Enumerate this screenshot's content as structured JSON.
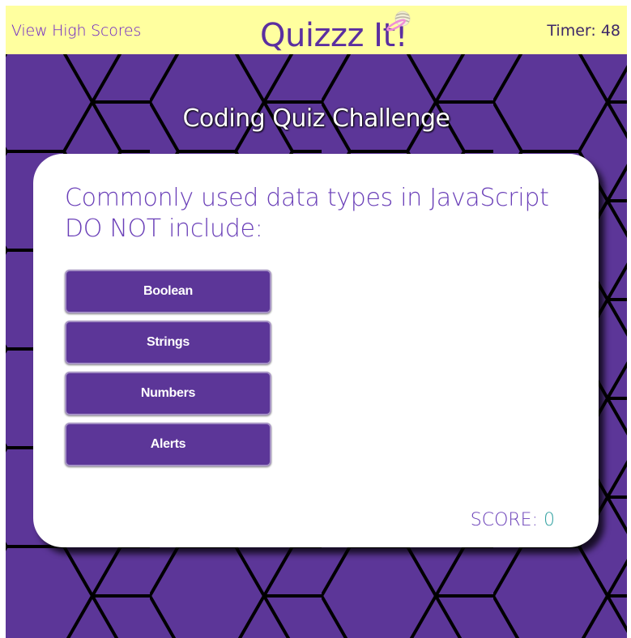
{
  "header": {
    "high_scores_link": "View High Scores",
    "brand": "Quizzz It!",
    "timer": "Timer: 48"
  },
  "main": {
    "title": "Coding Quiz Challenge",
    "question": "Commonly used data types in JavaScript DO NOT include:",
    "answers": [
      "Boolean",
      "Strings",
      "Numbers",
      "Alerts"
    ],
    "score_label": "SCORE:",
    "score_value": "0"
  },
  "colors": {
    "header_bg": "#ffff9f",
    "accent_purple": "#5c3698",
    "text_purple": "#6a3fb8",
    "score_teal": "#35a3a3"
  },
  "icons": {
    "logo": "ringed-planet-icon"
  }
}
